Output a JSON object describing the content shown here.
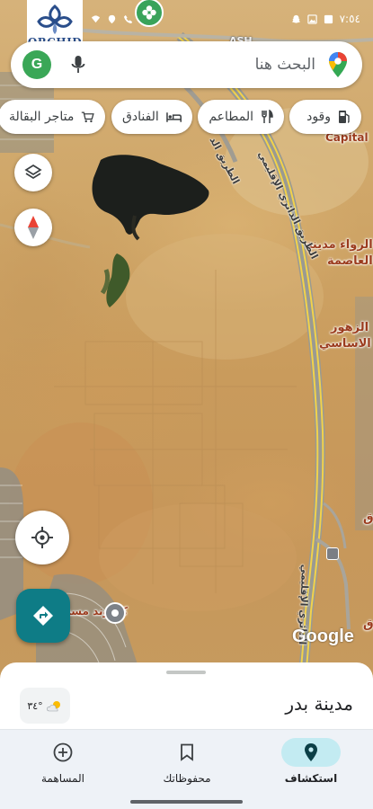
{
  "status_bar": {
    "clock": "٧:٥٤",
    "logo_text": "ORCHID"
  },
  "search": {
    "placeholder": "البحث هنا",
    "avatar_letter": "G"
  },
  "chips": [
    {
      "label": "وقود",
      "icon": "fuel-icon"
    },
    {
      "label": "المطاعم",
      "icon": "restaurant-icon"
    },
    {
      "label": "الفنادق",
      "icon": "hotel-icon"
    },
    {
      "label": "متاجر البقالة",
      "icon": "grocery-cart-icon"
    }
  ],
  "map": {
    "labels": {
      "top_edge": "ASH",
      "capital": "Capital",
      "rowaa_1": "الرواء مدينة",
      "rowaa_2": "العاصمة",
      "zohour_1": "الزهور",
      "zohour_2": "م الاساسي",
      "compound": "كمبوند مسة",
      "right_edge": "ق",
      "right_edge_2": "ق",
      "road_regional": "الطريق الدائري الإقليمي",
      "road_regional_2": "الدائري الإقليمي",
      "road_side": "الطريق الد"
    },
    "watermark": "Google"
  },
  "sheet": {
    "place_name": "مدينة بدر",
    "temperature": "٣٤°",
    "weather_icon": "partly-cloudy-icon"
  },
  "nav": {
    "items": [
      {
        "label": "استكشاف",
        "icon": "location-pin-icon",
        "active": true
      },
      {
        "label": "محفوظاتك",
        "icon": "bookmark-icon",
        "active": false
      },
      {
        "label": "المساهمة",
        "icon": "add-circle-icon",
        "active": false
      }
    ]
  },
  "colors": {
    "accent_teal": "#0e7c86",
    "active_nav_bg": "#c3ebf2",
    "avatar_green": "#3aa757"
  }
}
